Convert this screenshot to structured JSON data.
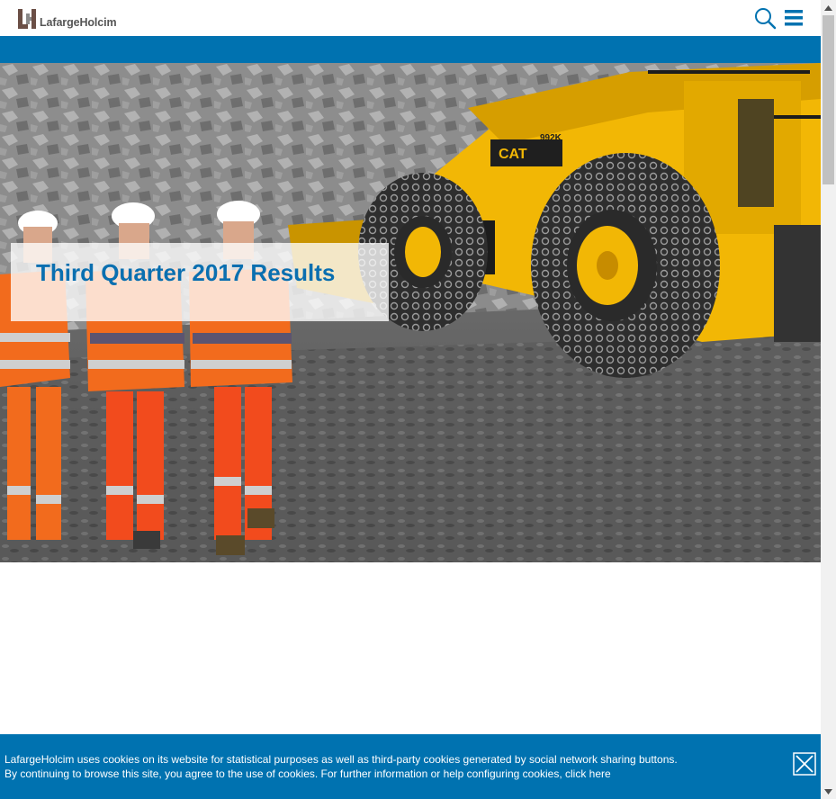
{
  "header": {
    "logo_text": "LafargeHolcim",
    "search_icon": "search-icon",
    "menu_icon": "hamburger-menu-icon"
  },
  "hero": {
    "title": "Third Quarter 2017 Results",
    "image_subject": "mining-photo",
    "truck_plate": "992K",
    "truck_brand": "CAT"
  },
  "cookie_banner": {
    "line1": "LafargeHolcim uses cookies on its website for statistical purposes as well as third-party cookies generated by social network sharing buttons.",
    "line2_prefix": "By continuing to browse this site, you agree to the use of cookies. For further information or help configuring cookies, ",
    "link_text": "click here",
    "close_icon": "close-icon"
  },
  "colors": {
    "brand_blue": "#0072b0",
    "title_blue": "#0a6fb0",
    "logo_gray": "#555555",
    "white": "#ffffff"
  }
}
